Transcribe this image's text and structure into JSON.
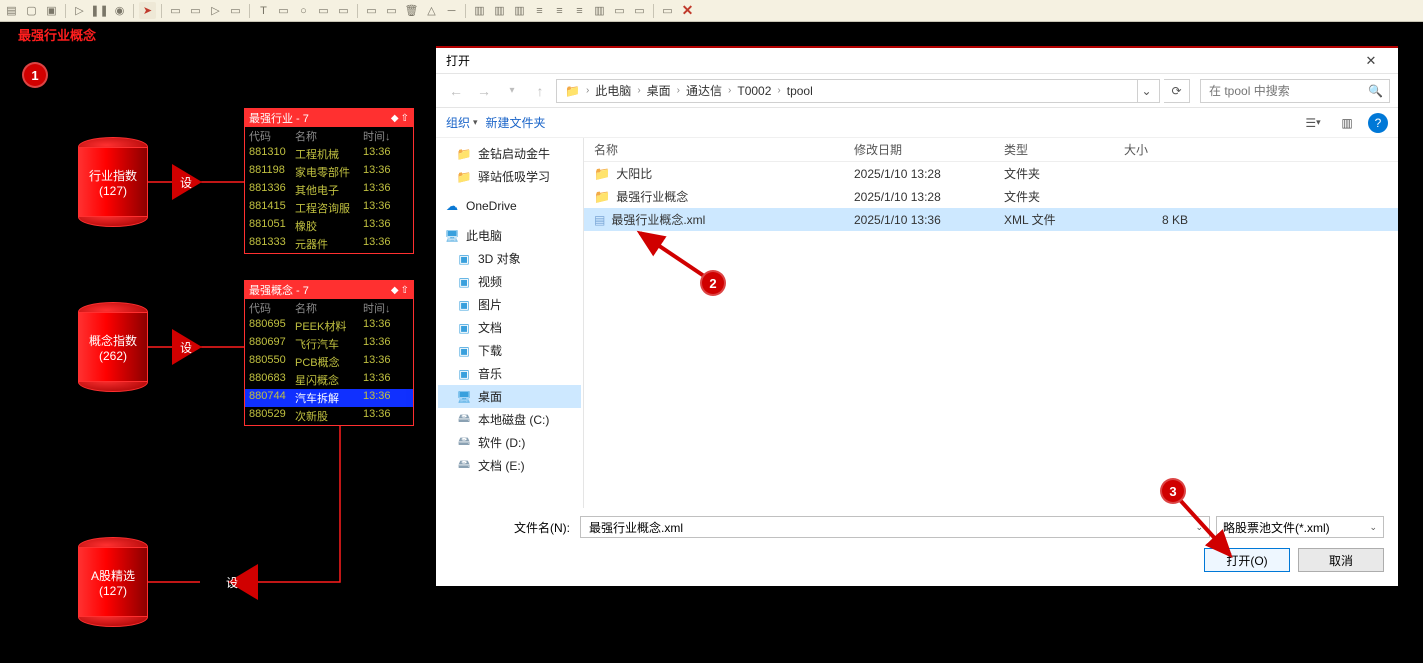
{
  "toolbar_close": "✕",
  "topleft_label": "最强行业概念",
  "annotations": {
    "b1": "1",
    "b2": "2",
    "b3": "3"
  },
  "cylinders": {
    "industry": {
      "line1": "行业指数",
      "line2": "(127)"
    },
    "concept": {
      "line1": "概念指数",
      "line2": "(262)"
    },
    "astock": {
      "line1": "A股精选",
      "line2": "(127)"
    }
  },
  "tri": {
    "label": "设"
  },
  "panel1": {
    "title": "最强行业 - 7",
    "head": {
      "c1": "代码",
      "c2": "名称",
      "c3": "时间↓"
    },
    "rows": [
      {
        "c1": "881310",
        "c2": "工程机械",
        "c3": "13:36"
      },
      {
        "c1": "881198",
        "c2": "家电零部件",
        "c3": "13:36"
      },
      {
        "c1": "881336",
        "c2": "其他电子",
        "c3": "13:36"
      },
      {
        "c1": "881415",
        "c2": "工程咨询服",
        "c3": "13:36"
      },
      {
        "c1": "881051",
        "c2": "橡胶",
        "c3": "13:36"
      },
      {
        "c1": "881333",
        "c2": "元器件",
        "c3": "13:36"
      }
    ]
  },
  "panel2": {
    "title": "最强概念 - 7",
    "head": {
      "c1": "代码",
      "c2": "名称",
      "c3": "时间↓"
    },
    "rows": [
      {
        "c1": "880695",
        "c2": "PEEK材料",
        "c3": "13:36"
      },
      {
        "c1": "880697",
        "c2": "飞行汽车",
        "c3": "13:36"
      },
      {
        "c1": "880550",
        "c2": "PCB概念",
        "c3": "13:36"
      },
      {
        "c1": "880683",
        "c2": "星闪概念",
        "c3": "13:36"
      },
      {
        "c1": "880744",
        "c2": "汽车拆解",
        "c3": "13:36",
        "sel": true
      },
      {
        "c1": "880529",
        "c2": "次新股",
        "c3": "13:36"
      }
    ]
  },
  "dialog": {
    "title": "打开",
    "breadcrumb": [
      "此电脑",
      "桌面",
      "通达信",
      "T0002",
      "tpool"
    ],
    "search_placeholder": "在 tpool 中搜索",
    "toolbar": {
      "organize": "组织",
      "mnemonic": "▾",
      "newfolder": "新建文件夹"
    },
    "tree": [
      {
        "icon": "folder",
        "label": "金钻启动金牛",
        "lvl": 1
      },
      {
        "icon": "folder",
        "label": "驿站低吸学习",
        "lvl": 1
      },
      {
        "icon": "cloud",
        "label": "OneDrive",
        "lvl": 0,
        "sep_above": true
      },
      {
        "icon": "monitor",
        "label": "此电脑",
        "lvl": 0,
        "sep_above": true
      },
      {
        "icon": "obj",
        "label": "3D 对象",
        "lvl": 1
      },
      {
        "icon": "obj",
        "label": "视频",
        "lvl": 1
      },
      {
        "icon": "obj",
        "label": "图片",
        "lvl": 1
      },
      {
        "icon": "obj",
        "label": "文档",
        "lvl": 1
      },
      {
        "icon": "obj",
        "label": "下载",
        "lvl": 1
      },
      {
        "icon": "obj",
        "label": "音乐",
        "lvl": 1
      },
      {
        "icon": "monitor",
        "label": "桌面",
        "lvl": 1,
        "sel": true
      },
      {
        "icon": "drive",
        "label": "本地磁盘 (C:)",
        "lvl": 1
      },
      {
        "icon": "drive",
        "label": "软件 (D:)",
        "lvl": 1
      },
      {
        "icon": "drive",
        "label": "文档 (E:)",
        "lvl": 1
      }
    ],
    "filehead": {
      "name": "名称",
      "date": "修改日期",
      "type": "类型",
      "size": "大小"
    },
    "files": [
      {
        "name": "大阳比",
        "date": "2025/1/10 13:28",
        "type": "文件夹",
        "size": "",
        "icon": "folder"
      },
      {
        "name": "最强行业概念",
        "date": "2025/1/10 13:28",
        "type": "文件夹",
        "size": "",
        "icon": "folder"
      },
      {
        "name": "最强行业概念.xml",
        "date": "2025/1/10 13:36",
        "type": "XML 文件",
        "size": "8 KB",
        "icon": "xml",
        "sel": true
      }
    ],
    "filename_label": "文件名(N):",
    "filename_value": "最强行业概念.xml",
    "filter": "略股票池文件(*.xml)",
    "open_btn": "打开(O)",
    "cancel_btn": "取消"
  }
}
